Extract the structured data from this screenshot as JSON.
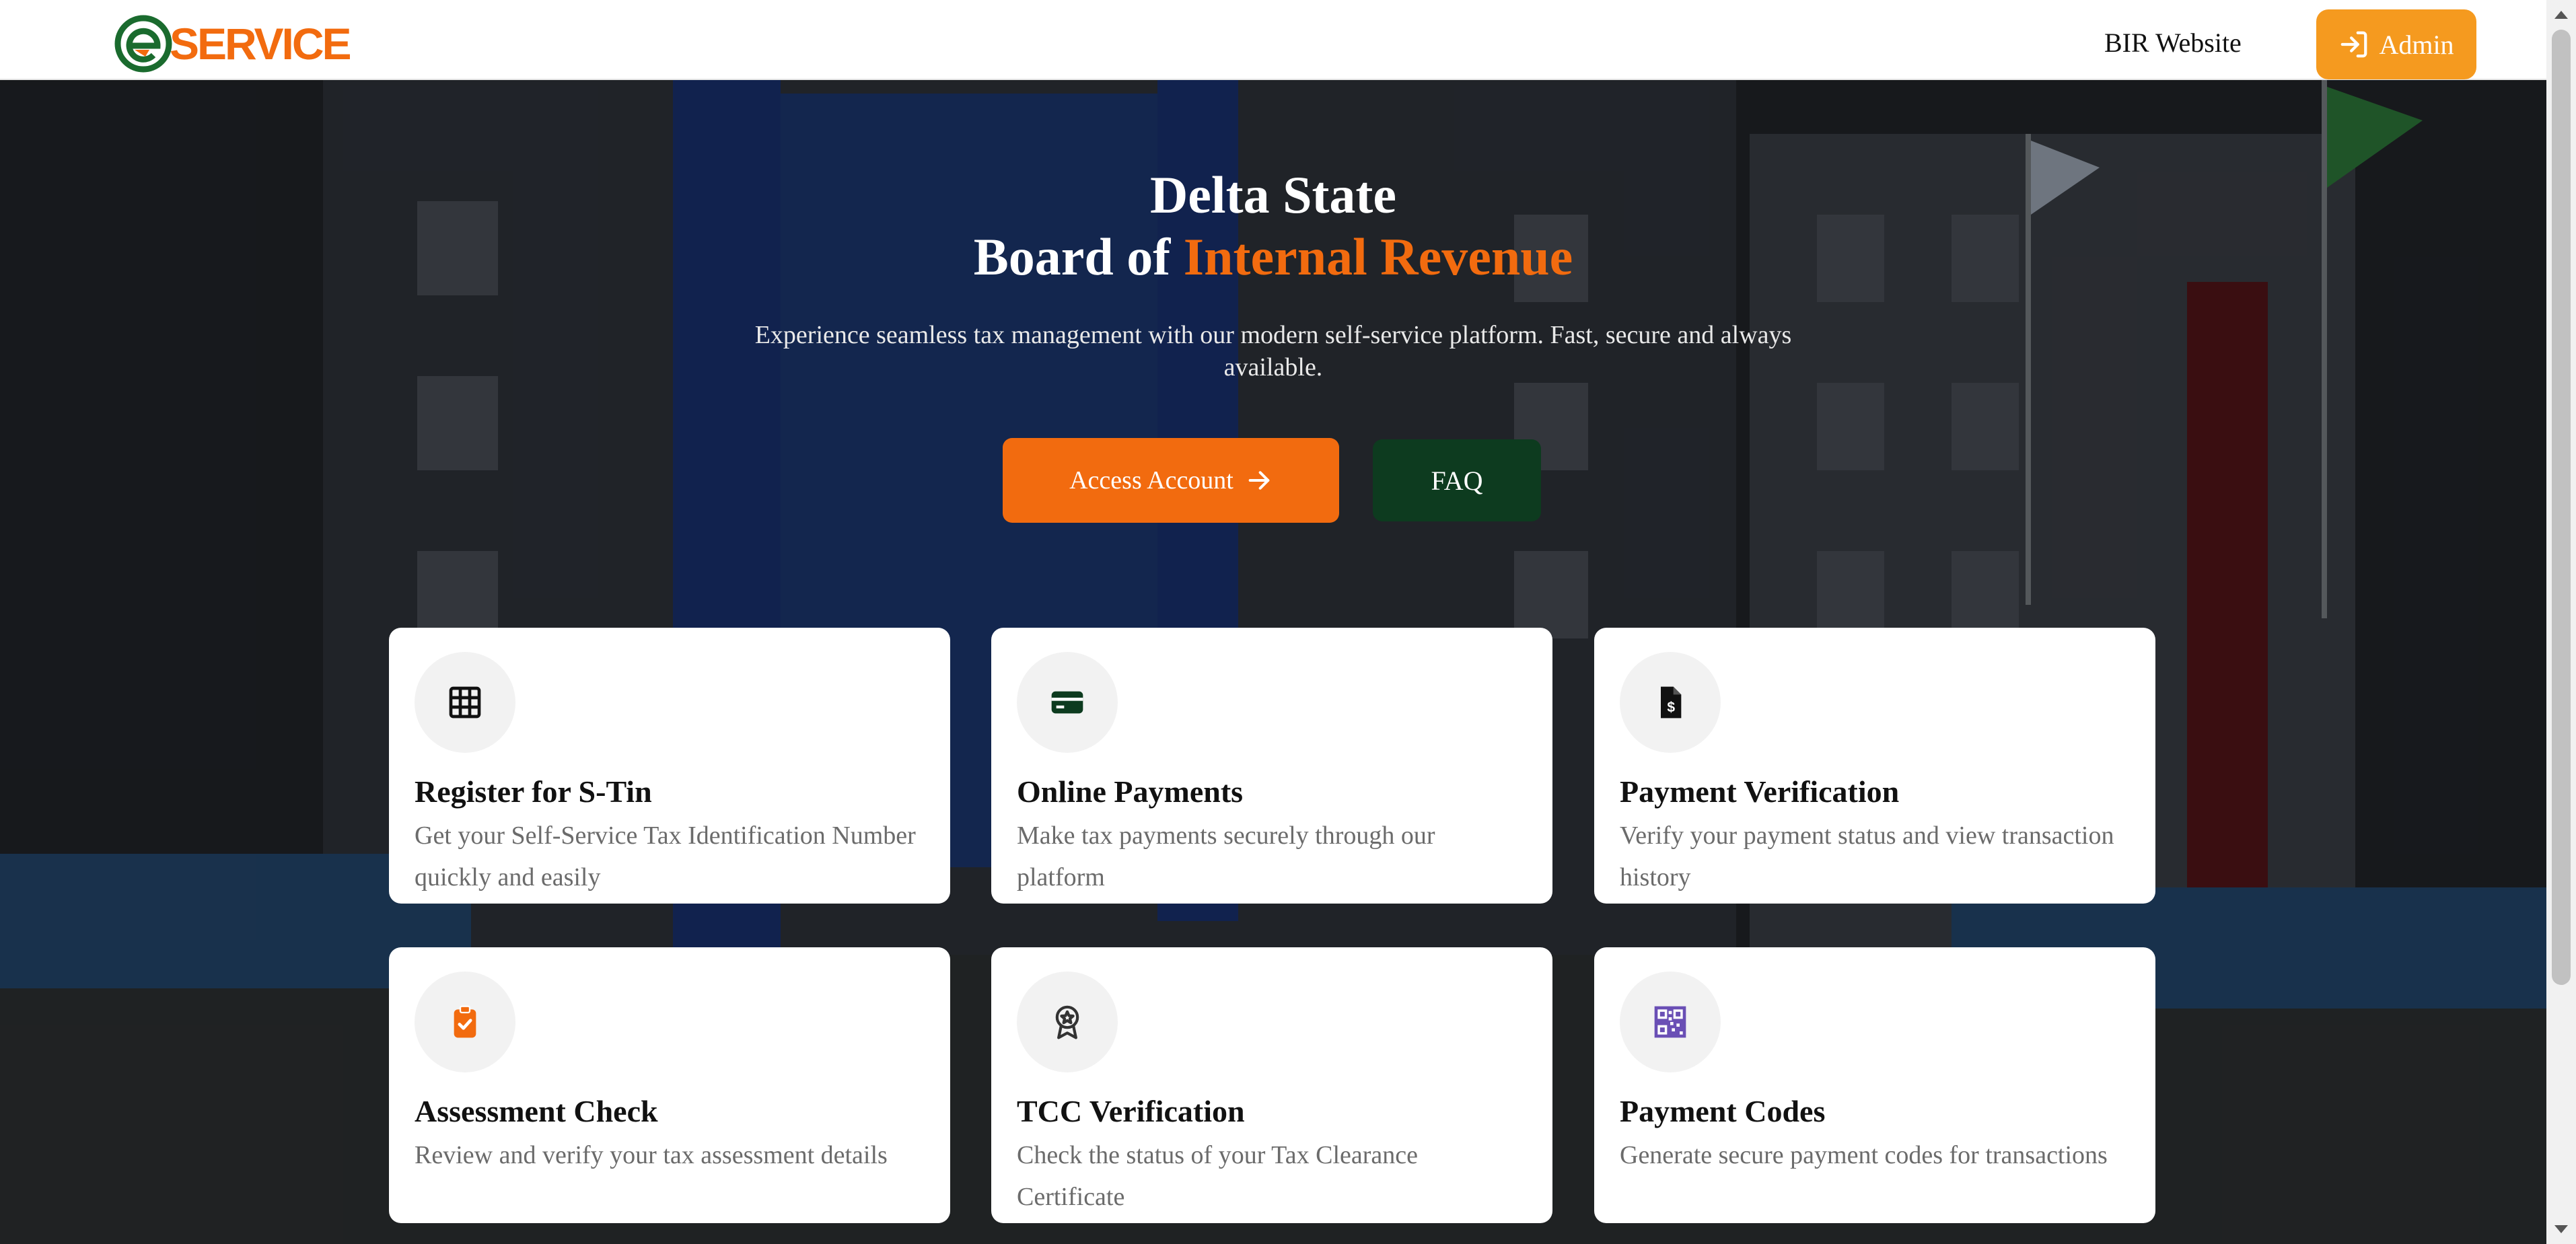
{
  "brand": {
    "name": "SERVICE",
    "logo_letter": "e",
    "accent_color": "#f26b0f",
    "logo_green": "#1a6b2e"
  },
  "nav": {
    "bir_website": "BIR Website",
    "admin_label": "Admin",
    "admin_color": "#f59a1f"
  },
  "hero": {
    "title_line1": "Delta State",
    "title_line2_prefix": "Board of ",
    "title_line2_accent": "Internal Revenue",
    "subtitle": "Experience seamless tax management with our modern self-service platform. Fast, secure and always available.",
    "primary_button": "Access Account",
    "secondary_button": "FAQ",
    "secondary_color": "#0d3b1f"
  },
  "cards": [
    {
      "icon": "grid-icon",
      "title": "Register for S-Tin",
      "description": "Get your Self-Service Tax Identification Number quickly and easily"
    },
    {
      "icon": "credit-card-icon",
      "title": "Online Payments",
      "description": "Make tax payments securely through our platform"
    },
    {
      "icon": "file-dollar-icon",
      "title": "Payment Verification",
      "description": "Verify your payment status and view transaction history"
    },
    {
      "icon": "clipboard-check-icon",
      "title": "Assessment Check",
      "description": "Review and verify your tax assessment details"
    },
    {
      "icon": "award-icon",
      "title": "TCC Verification",
      "description": "Check the status of your Tax Clearance Certificate"
    },
    {
      "icon": "qr-code-icon",
      "title": "Payment Codes",
      "description": "Generate secure payment codes for transactions"
    }
  ]
}
